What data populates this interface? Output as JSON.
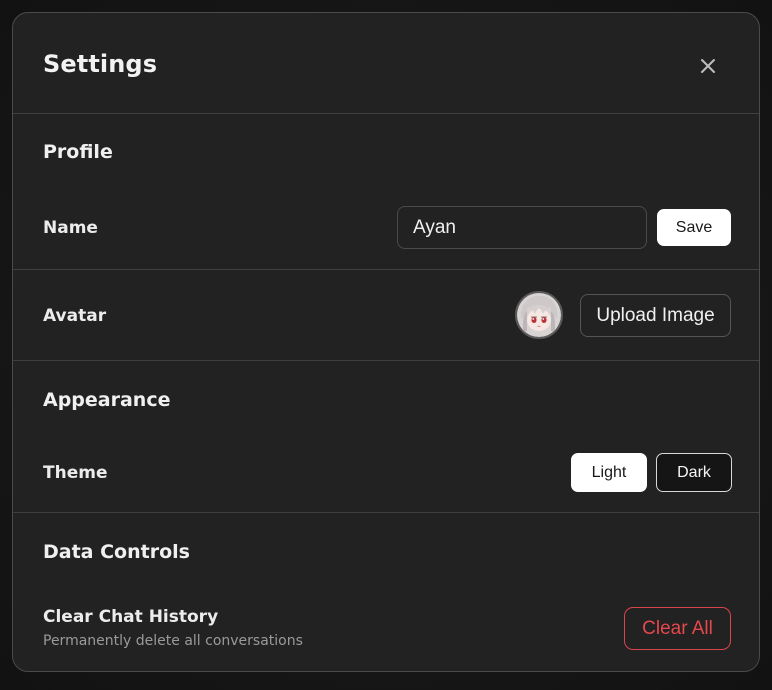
{
  "dialog": {
    "title": "Settings",
    "close_icon": "close-icon"
  },
  "profile": {
    "section_title": "Profile",
    "name_label": "Name",
    "name_value": "Ayan",
    "save_label": "Save",
    "avatar_label": "Avatar",
    "avatar_icon": "anime-avatar-image",
    "upload_label": "Upload Image"
  },
  "appearance": {
    "section_title": "Appearance",
    "theme_label": "Theme",
    "theme_options": [
      "Light",
      "Dark"
    ],
    "selected_theme": "Dark"
  },
  "data_controls": {
    "section_title": "Data Controls",
    "clear_label": "Clear Chat History",
    "clear_description": "Permanently delete all conversations",
    "clear_button": "Clear All"
  },
  "colors": {
    "background": "#222222",
    "border": "#3f3f3f",
    "danger": "#e5484d",
    "muted_text": "#9a9a9a"
  }
}
